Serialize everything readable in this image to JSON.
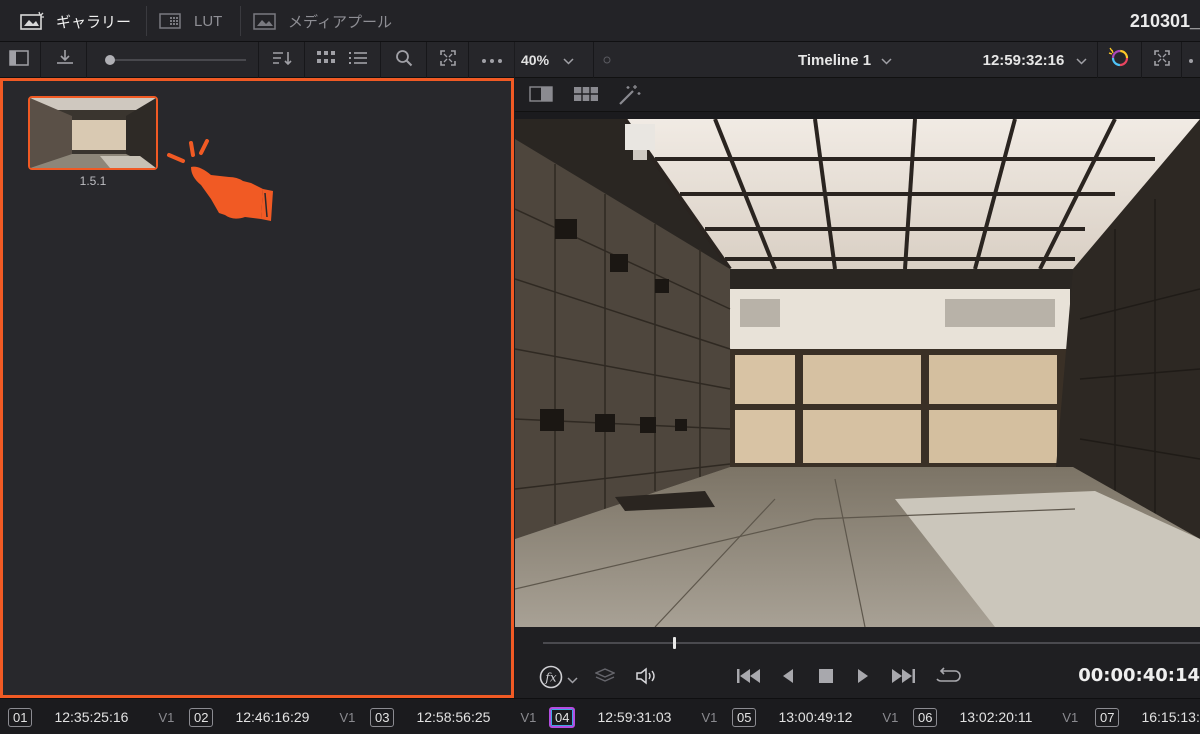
{
  "top_tabs": [
    {
      "label": "ギャラリー",
      "icon": "gallery-icon",
      "active": true
    },
    {
      "label": "LUT",
      "icon": "lut-icon",
      "active": false
    },
    {
      "label": "メディアプール",
      "icon": "media-pool-icon",
      "active": false
    }
  ],
  "project_title": "210301_",
  "viewer_toolbar": {
    "zoom": "40%",
    "timeline_name": "Timeline 1",
    "source_timecode": "12:59:32:16"
  },
  "gallery": {
    "stills": [
      {
        "label": "1.5.1",
        "selected": true
      }
    ],
    "annotation_icon": "pointing-hand-icon"
  },
  "transport": {
    "timecode": "00:00:40:14",
    "scrub_position": 0.198
  },
  "clips": [
    {
      "num": "01",
      "timecode": "12:35:25:16",
      "track": "V1",
      "active": false
    },
    {
      "num": "02",
      "timecode": "12:46:16:29",
      "track": "V1",
      "active": false
    },
    {
      "num": "03",
      "timecode": "12:58:56:25",
      "track": "V1",
      "active": false
    },
    {
      "num": "04",
      "timecode": "12:59:31:03",
      "track": "V1",
      "active": true
    },
    {
      "num": "05",
      "timecode": "13:00:49:12",
      "track": "V1",
      "active": false
    },
    {
      "num": "06",
      "timecode": "13:02:20:11",
      "track": "V1",
      "active": false
    },
    {
      "num": "07",
      "timecode": "16:15:13:",
      "track": "",
      "active": false
    }
  ],
  "colors": {
    "accent_orange": "#f15a24",
    "panel_bg": "#28282c",
    "active_clip_border": "#b44de0"
  }
}
